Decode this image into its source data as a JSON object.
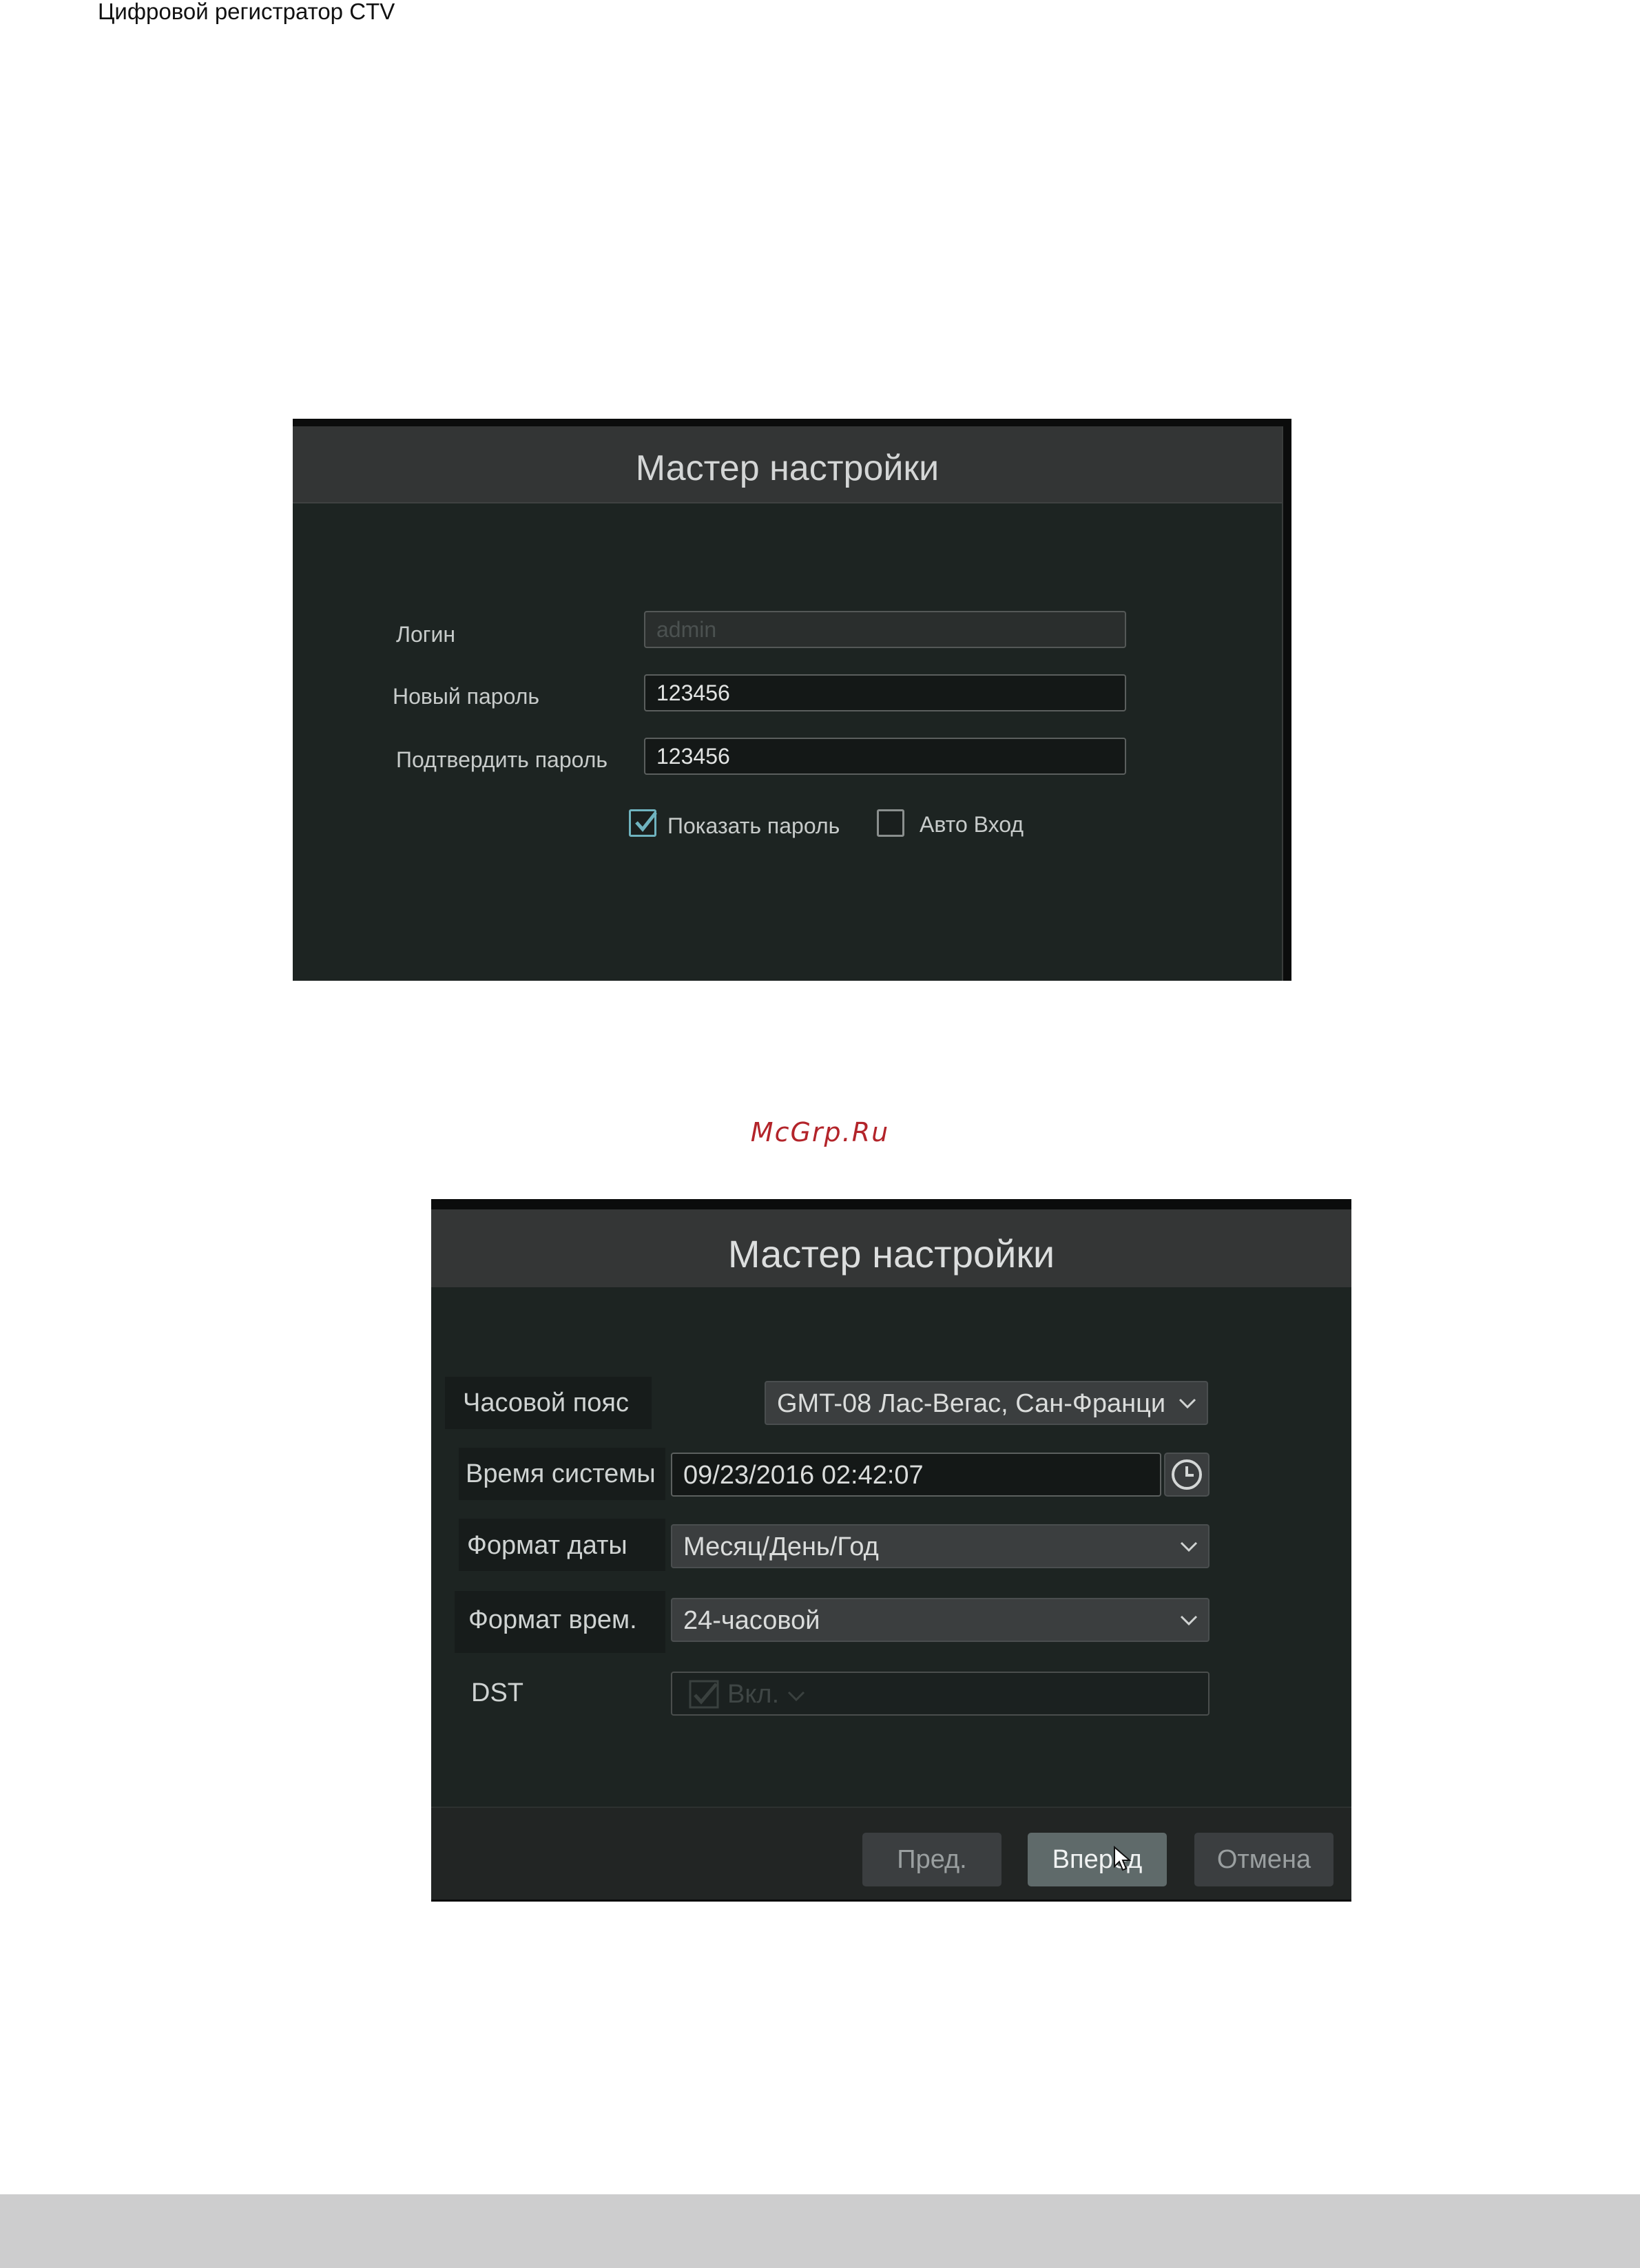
{
  "doc_header": "Цифровой регистратор CTV",
  "watermark": "McGrp.Ru",
  "screen1": {
    "title": "Мастер настройки",
    "login_label": "Логин",
    "login_placeholder": "admin",
    "new_password_label": "Новый  пароль",
    "new_password_value": "123456",
    "confirm_password_label": "Подтвердить пароль",
    "confirm_password_value": "123456",
    "show_password_label": "Показать пароль",
    "show_password_checked": true,
    "auto_login_label": "Авто Вход",
    "auto_login_checked": false
  },
  "screen2": {
    "title": "Мастер настройки",
    "timezone_label": "Часовой пояс",
    "timezone_value": "GMT-08 Лас-Вегас, Сан-Франци",
    "system_time_label": "Время системы",
    "system_time_value": "09/23/2016 02:42:07",
    "date_format_label": "Формат даты",
    "date_format_value": "Месяц/День/Год",
    "time_format_label": "Формат врем.",
    "time_format_value": "24-часовой",
    "dst_label": "DST",
    "dst_value": "Вкл.",
    "buttons": {
      "prev": "Пред.",
      "next": "Вперед",
      "cancel": "Отмена"
    }
  },
  "icons": {
    "clock": "clock-icon",
    "chevron": "chevron-down-icon",
    "check": "check-icon",
    "cursor": "mouse-cursor-icon"
  },
  "colors": {
    "accent_check": "#6fb3bf",
    "panel_bg": "#1d2422",
    "titlebar_bg": "#343636",
    "watermark": "#b3242a"
  }
}
